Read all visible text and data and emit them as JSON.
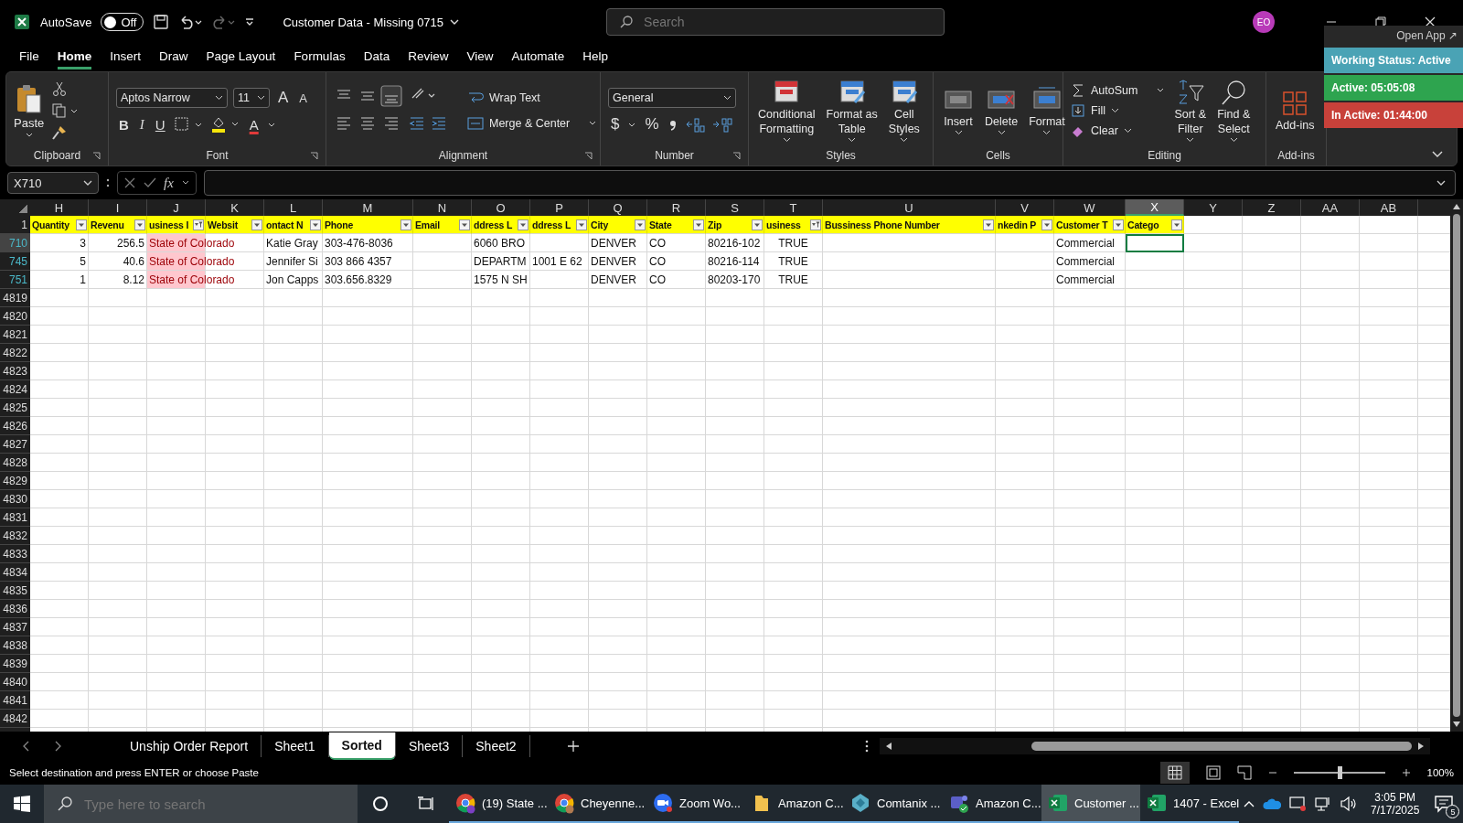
{
  "title_bar": {
    "autosave": {
      "label": "AutoSave",
      "on": false,
      "state_text": "Off"
    },
    "title": "Customer Data - Missing 0715",
    "search": {
      "placeholder": "Search"
    },
    "avatar": "EO"
  },
  "menu_tabs": [
    {
      "label": "File",
      "selected": false
    },
    {
      "label": "Home",
      "selected": true
    },
    {
      "label": "Insert",
      "selected": false
    },
    {
      "label": "Draw",
      "selected": false
    },
    {
      "label": "Page Layout",
      "selected": false
    },
    {
      "label": "Formulas",
      "selected": false
    },
    {
      "label": "Data",
      "selected": false
    },
    {
      "label": "Review",
      "selected": false
    },
    {
      "label": "View",
      "selected": false
    },
    {
      "label": "Automate",
      "selected": false
    },
    {
      "label": "Help",
      "selected": false
    }
  ],
  "ribbon": {
    "clipboard": {
      "paste": "Paste",
      "label": "Clipboard"
    },
    "font": {
      "family": "Aptos Narrow",
      "size": "11",
      "grow": "A",
      "shrink": "A",
      "bold": "B",
      "italic": "I",
      "underline": "U",
      "font_color": "A",
      "label": "Font"
    },
    "alignment": {
      "wrap": "Wrap Text",
      "merge": "Merge & Center",
      "label": "Alignment"
    },
    "number": {
      "format": "General",
      "currency": "$",
      "percent": "%",
      "label": "Number"
    },
    "styles": {
      "buttons": [
        [
          "Conditional",
          "Formatting"
        ],
        [
          "Format as",
          "Table"
        ],
        [
          "Cell",
          "Styles"
        ]
      ],
      "label": "Styles"
    },
    "cells": {
      "buttons": [
        "Insert",
        "Delete",
        "Format"
      ],
      "label": "Cells"
    },
    "editing": {
      "autosum": "AutoSum",
      "fill": "Fill",
      "clear": "Clear",
      "sort": [
        "Sort &",
        "Filter"
      ],
      "find": [
        "Find &",
        "Select"
      ],
      "label": "Editing"
    },
    "addins": {
      "button": "Add-ins",
      "label": "Add-ins"
    }
  },
  "status_widget": {
    "open_app": "Open App ↗",
    "items": [
      {
        "text": "Working Status: Active",
        "color": "#4aa3b5"
      },
      {
        "text": "Active: 05:05:08",
        "color": "#2ea44f"
      },
      {
        "text": "In Active: 01:44:00",
        "color": "#c8413a"
      }
    ]
  },
  "formula_bar": {
    "name_box": "X710",
    "function_label": "fx"
  },
  "sheet": {
    "columns": [
      {
        "letter": "H",
        "selected": false
      },
      {
        "letter": "I",
        "selected": false
      },
      {
        "letter": "J",
        "selected": false
      },
      {
        "letter": "K",
        "selected": false
      },
      {
        "letter": "L",
        "selected": false
      },
      {
        "letter": "M",
        "selected": false
      },
      {
        "letter": "N",
        "selected": false
      },
      {
        "letter": "O",
        "selected": false
      },
      {
        "letter": "P",
        "selected": false
      },
      {
        "letter": "Q",
        "selected": false
      },
      {
        "letter": "R",
        "selected": false
      },
      {
        "letter": "S",
        "selected": false
      },
      {
        "letter": "T",
        "selected": false
      },
      {
        "letter": "U",
        "selected": false
      },
      {
        "letter": "V",
        "selected": false
      },
      {
        "letter": "W",
        "selected": false
      },
      {
        "letter": "X",
        "selected": true
      },
      {
        "letter": "Y",
        "selected": false
      },
      {
        "letter": "Z",
        "selected": false
      },
      {
        "letter": "AA",
        "selected": false
      },
      {
        "letter": "AB",
        "selected": false
      }
    ],
    "header_row": {
      "number": "1",
      "cells": [
        {
          "text": "Quantity",
          "filtered": false
        },
        {
          "text": "Revenu",
          "filtered": false
        },
        {
          "text": "usiness I",
          "filtered": true
        },
        {
          "text": "Websit",
          "filtered": false
        },
        {
          "text": "ontact N",
          "filtered": false
        },
        {
          "text": "Phone",
          "filtered": false
        },
        {
          "text": "Email",
          "filtered": false
        },
        {
          "text": "ddress L",
          "filtered": false
        },
        {
          "text": "ddress L",
          "filtered": false
        },
        {
          "text": "City",
          "filtered": false
        },
        {
          "text": "State",
          "filtered": false
        },
        {
          "text": "Zip",
          "filtered": false
        },
        {
          "text": "usiness",
          "filtered": true
        },
        {
          "text": "Bussiness Phone Number",
          "filtered": false
        },
        {
          "text": "nkedin P",
          "filtered": false
        },
        {
          "text": "Customer T",
          "filtered": false
        },
        {
          "text": "Catego",
          "filtered": false
        }
      ]
    },
    "data_rows": [
      {
        "number": "710",
        "selected": true,
        "cells": [
          {
            "text": "3",
            "kind": "number",
            "highlighted": false
          },
          {
            "text": "256.5",
            "kind": "number",
            "highlighted": false
          },
          {
            "text": "State of Colorado",
            "kind": "text",
            "highlighted": true
          },
          null,
          {
            "text": "Katie Gray",
            "kind": "text",
            "highlighted": false
          },
          {
            "text": "303-476-8036",
            "kind": "text",
            "highlighted": false
          },
          null,
          {
            "text": "6060 BRO",
            "kind": "text",
            "highlighted": false
          },
          null,
          {
            "text": "DENVER",
            "kind": "text",
            "highlighted": false
          },
          {
            "text": "CO",
            "kind": "text",
            "highlighted": false
          },
          {
            "text": "80216-102",
            "kind": "text",
            "highlighted": false
          },
          {
            "text": "TRUE",
            "kind": "center",
            "highlighted": false
          },
          null,
          null,
          {
            "text": "Commercial",
            "kind": "text",
            "highlighted": false
          }
        ]
      },
      {
        "number": "745",
        "selected": false,
        "cells": [
          {
            "text": "5",
            "kind": "number",
            "highlighted": false
          },
          {
            "text": "40.6",
            "kind": "number",
            "highlighted": false
          },
          {
            "text": "State of Colorado",
            "kind": "text",
            "highlighted": true
          },
          null,
          {
            "text": "Jennifer Si",
            "kind": "text",
            "highlighted": false
          },
          {
            "text": "303 866 4357",
            "kind": "text",
            "highlighted": false
          },
          null,
          {
            "text": "DEPARTM",
            "kind": "text",
            "highlighted": false
          },
          {
            "text": "1001 E 62",
            "kind": "text",
            "highlighted": false
          },
          {
            "text": "DENVER",
            "kind": "text",
            "highlighted": false
          },
          {
            "text": "CO",
            "kind": "text",
            "highlighted": false
          },
          {
            "text": "80216-114",
            "kind": "text",
            "highlighted": false
          },
          {
            "text": "TRUE",
            "kind": "center",
            "highlighted": false
          },
          null,
          null,
          {
            "text": "Commercial",
            "kind": "text",
            "highlighted": false
          }
        ]
      },
      {
        "number": "751",
        "selected": false,
        "cells": [
          {
            "text": "1",
            "kind": "number",
            "highlighted": false
          },
          {
            "text": "8.12",
            "kind": "number",
            "highlighted": false
          },
          {
            "text": "State of Colorado",
            "kind": "text",
            "highlighted": true
          },
          null,
          {
            "text": "Jon Capps",
            "kind": "text",
            "highlighted": false
          },
          {
            "text": "303.656.8329",
            "kind": "text",
            "highlighted": false
          },
          null,
          {
            "text": "1575 N SH",
            "kind": "text",
            "highlighted": false
          },
          null,
          {
            "text": "DENVER",
            "kind": "text",
            "highlighted": false
          },
          {
            "text": "CO",
            "kind": "text",
            "highlighted": false
          },
          {
            "text": "80203-170",
            "kind": "text",
            "highlighted": false
          },
          {
            "text": "TRUE",
            "kind": "center",
            "highlighted": false
          },
          null,
          null,
          {
            "text": "Commercial",
            "kind": "text",
            "highlighted": false
          }
        ]
      }
    ],
    "empty_rows": [
      "4819",
      "4820",
      "4821",
      "4822",
      "4823",
      "4824",
      "4825",
      "4826",
      "4827",
      "4828",
      "4829",
      "4830",
      "4831",
      "4832",
      "4833",
      "4834",
      "4835",
      "4836",
      "4837",
      "4838",
      "4839",
      "4840",
      "4841",
      "4842"
    ]
  },
  "sheet_tabs": [
    {
      "label": "Unship Order Report",
      "selected": false
    },
    {
      "label": "Sheet1",
      "selected": false
    },
    {
      "label": "Sorted",
      "selected": true
    },
    {
      "label": "Sheet3",
      "selected": false
    },
    {
      "label": "Sheet2",
      "selected": false
    }
  ],
  "status_bar": {
    "message": "Select destination and press ENTER or choose Paste",
    "zoom": {
      "level": 0.5,
      "reading": "100%"
    }
  },
  "taskbar": {
    "search": {
      "placeholder": "Type here to search"
    },
    "apps": [
      {
        "label": "(19) State ...",
        "selected": false
      },
      {
        "label": "Cheyenne...",
        "selected": false
      },
      {
        "label": "Zoom Wo...",
        "selected": false
      },
      {
        "label": "Amazon C...",
        "selected": false
      },
      {
        "label": "Comtanix ...",
        "selected": false
      },
      {
        "label": "Amazon C...",
        "selected": false
      },
      {
        "label": "Customer ...",
        "selected": true
      },
      {
        "label": "1407 - Excel",
        "selected": false
      }
    ],
    "time": "3:05 PM",
    "date": "7/17/2025",
    "notifications": "5"
  }
}
